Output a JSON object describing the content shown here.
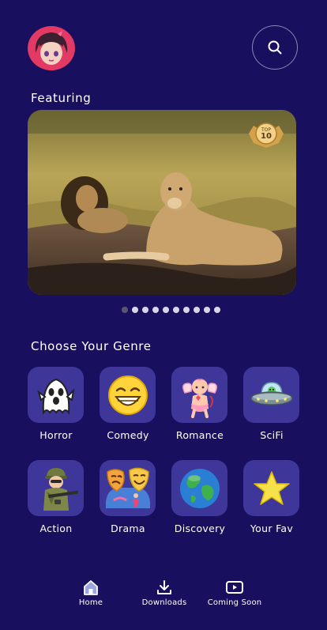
{
  "header": {
    "avatar_icon": "avatar-anime-girl",
    "search_icon": "search-icon"
  },
  "featuring": {
    "title": "Featuring",
    "hero_badge": {
      "line1": "TOP",
      "line2": "10"
    },
    "carousel": {
      "count": 10,
      "active_index": 0
    }
  },
  "genres": {
    "title": "Choose Your Genre",
    "items": [
      {
        "label": "Horror",
        "icon": "ghost-icon"
      },
      {
        "label": "Comedy",
        "icon": "laughing-face-icon"
      },
      {
        "label": "Romance",
        "icon": "cupid-icon"
      },
      {
        "label": "SciFi",
        "icon": "ufo-icon"
      },
      {
        "label": "Action",
        "icon": "soldier-icon"
      },
      {
        "label": "Drama",
        "icon": "theater-masks-icon"
      },
      {
        "label": "Discovery",
        "icon": "globe-icon"
      },
      {
        "label": "Your Fav",
        "icon": "star-icon"
      }
    ]
  },
  "nav": {
    "home": "Home",
    "downloads": "Downloads",
    "coming_soon": "Coming Soon"
  },
  "colors": {
    "background": "#180f5e",
    "tile": "#3f3699",
    "accent_star": "#f6e14a"
  }
}
